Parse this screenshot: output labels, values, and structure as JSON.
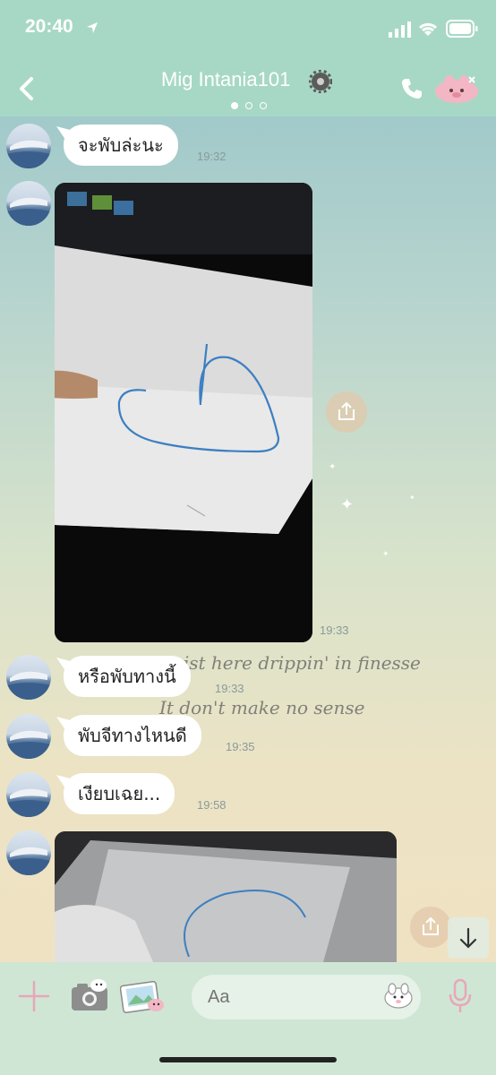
{
  "status_bar": {
    "time": "20:40"
  },
  "header": {
    "title": "Mig Intania101"
  },
  "messages": [
    {
      "text": "จะพับล่ะนะ",
      "time": "19:32"
    },
    {
      "time": "19:33"
    },
    {
      "text": "หรือพับทางนี้",
      "time": "19:33"
    },
    {
      "text": "พับจีทางไหนดี",
      "time": "19:35"
    },
    {
      "text": "เงียบเฉย...",
      "time": "19:58"
    }
  ],
  "overlay_lyrics": [
    "My wrist here drippin' in finesse",
    "It don't make no sense"
  ],
  "input": {
    "placeholder": "Aa"
  },
  "colors": {
    "header_bg": "#a7d8c6",
    "input_bar_bg": "#cfe6d5",
    "accent_pink": "#e8a7b8"
  }
}
